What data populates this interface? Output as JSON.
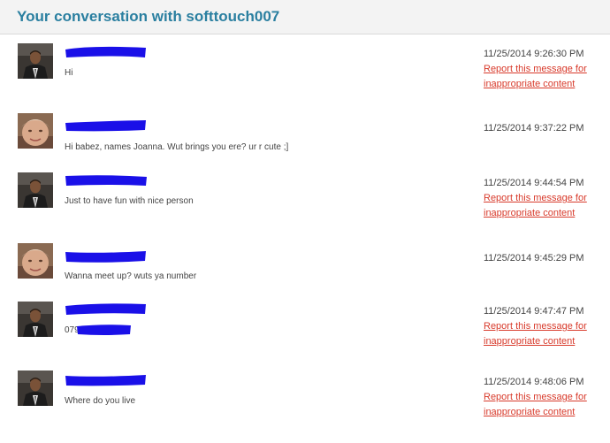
{
  "header": {
    "title": "Your conversation with softtouch007"
  },
  "report_label": "Report this message for inappropriate content",
  "colors": {
    "title": "#2a7fa0",
    "report_link": "#d83a2b",
    "redaction": "#1a10e8"
  },
  "messages": [
    {
      "avatar": "man-avatar",
      "text": "Hi",
      "time": "11/25/2014 9:26:30 PM",
      "report": true
    },
    {
      "avatar": "woman-avatar",
      "text": "Hi babez, names Joanna. Wut brings you ere? ur r cute ;]",
      "time": "11/25/2014 9:37:22 PM",
      "report": false
    },
    {
      "avatar": "man-avatar",
      "text": "Just to have fun with nice person",
      "time": "11/25/2014 9:44:54 PM",
      "report": true
    },
    {
      "avatar": "woman-avatar",
      "text": "Wanna meet up? wuts ya number",
      "time": "11/25/2014 9:45:29 PM",
      "report": false
    },
    {
      "avatar": "man-avatar",
      "text": "079",
      "time": "11/25/2014 9:47:47 PM",
      "report": true
    },
    {
      "avatar": "man-avatar",
      "text": "Where do you live",
      "time": "11/25/2014 9:48:06 PM",
      "report": true
    }
  ]
}
